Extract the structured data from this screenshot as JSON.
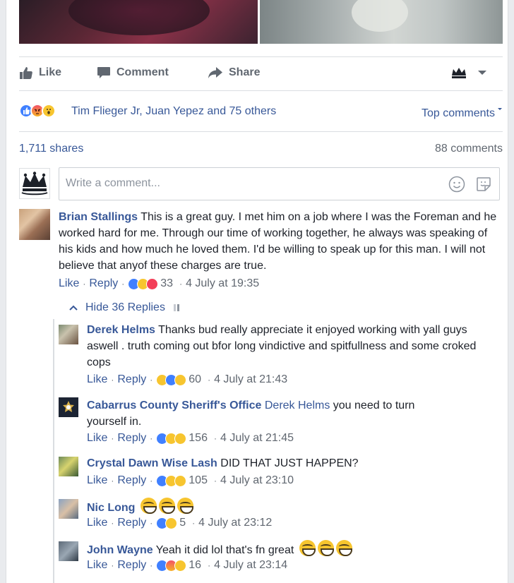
{
  "actions": {
    "like": "Like",
    "comment": "Comment",
    "share": "Share"
  },
  "reactions_summary": {
    "names": "Tim Flieger Jr, Juan Yepez and 75 others",
    "sort_label": "Top comments"
  },
  "stats": {
    "shares": "1,711 shares",
    "comments": "88 comments"
  },
  "composer": {
    "placeholder": "Write a comment..."
  },
  "comments": [
    {
      "author": "Brian Stallings",
      "text": "This is a great guy. I met him on a job where I was the Foreman and he worked hard for me. Through our time of working together, he always was speaking of his kids and how much he loved them. I'd be willing to speak up for this man. I will not believe that anyof these charges are true.",
      "like": "Like",
      "reply": "Reply",
      "reaction_count": "33",
      "time": "4 July at 19:35"
    }
  ],
  "hide_replies": "Hide 36 Replies",
  "replies": [
    {
      "author": "Derek Helms",
      "text": "Thanks bud really appreciate it enjoyed working with yall guys aswell . truth coming out bfor long vindictive and spitfullness and some croked cops",
      "like": "Like",
      "reply": "Reply",
      "reaction_count": "60",
      "time": "4 July at 21:43"
    },
    {
      "author": "Cabarrus County Sheriff's Office",
      "mention": "Derek Helms",
      "text": "you need to turn yourself in.",
      "like": "Like",
      "reply": "Reply",
      "reaction_count": "156",
      "time": "4 July at 21:45"
    },
    {
      "author": "Crystal Dawn Wise Lash",
      "text": "DID THAT JUST HAPPEN?",
      "like": "Like",
      "reply": "Reply",
      "reaction_count": "105",
      "time": "4 July at 23:10"
    },
    {
      "author": "Nic Long",
      "text": "",
      "like": "Like",
      "reply": "Reply",
      "reaction_count": "5",
      "time": "4 July at 23:12"
    },
    {
      "author": "John Wayne",
      "text": "Yeah it did lol that's fn great",
      "like": "Like",
      "reply": "Reply",
      "reaction_count": "16",
      "time": "4 July at 23:14"
    }
  ],
  "colors": {
    "link": "#385898",
    "meta": "#606770",
    "like_blue": "#4080ff",
    "divider": "#dadde1"
  }
}
